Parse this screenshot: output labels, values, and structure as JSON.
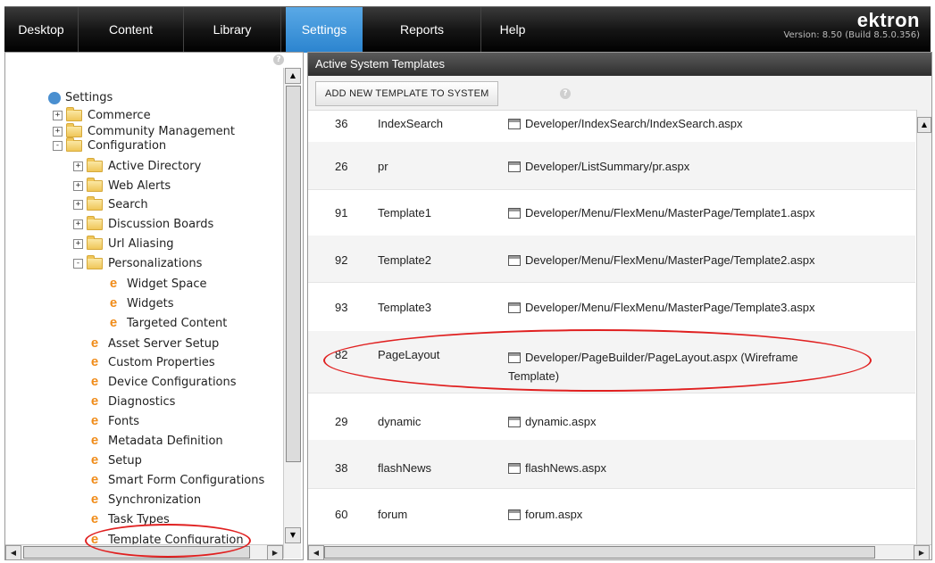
{
  "nav": {
    "tabs": [
      {
        "label": "Desktop"
      },
      {
        "label": "Content"
      },
      {
        "label": "Library"
      },
      {
        "label": "Settings",
        "active": true
      },
      {
        "label": "Reports"
      },
      {
        "label": "Help"
      }
    ],
    "brand": "ektron",
    "version": "Version: 8.50 (Build 8.5.0.356)"
  },
  "tree": {
    "root": "Settings",
    "items": [
      {
        "label": "Commerce",
        "type": "folder",
        "state": "+"
      },
      {
        "label": "Community Management",
        "type": "folder",
        "state": "+"
      },
      {
        "label": "Configuration",
        "type": "folder",
        "state": "-"
      },
      {
        "label": "Active Directory",
        "type": "folder",
        "state": "+"
      },
      {
        "label": "Web Alerts",
        "type": "folder",
        "state": "+"
      },
      {
        "label": "Search",
        "type": "folder",
        "state": "+"
      },
      {
        "label": "Discussion Boards",
        "type": "folder",
        "state": "+"
      },
      {
        "label": "Url Aliasing",
        "type": "folder",
        "state": "+"
      },
      {
        "label": "Personalizations",
        "type": "folder",
        "state": "-"
      },
      {
        "label": "Widget Space",
        "type": "leaf"
      },
      {
        "label": "Widgets",
        "type": "leaf"
      },
      {
        "label": "Targeted Content",
        "type": "leaf"
      },
      {
        "label": "Asset Server Setup",
        "type": "leaf"
      },
      {
        "label": "Custom Properties",
        "type": "leaf"
      },
      {
        "label": "Device Configurations",
        "type": "leaf"
      },
      {
        "label": "Diagnostics",
        "type": "leaf"
      },
      {
        "label": "Fonts",
        "type": "leaf"
      },
      {
        "label": "Metadata Definition",
        "type": "leaf"
      },
      {
        "label": "Setup",
        "type": "leaf"
      },
      {
        "label": "Smart Form Configurations",
        "type": "leaf"
      },
      {
        "label": "Synchronization",
        "type": "leaf"
      },
      {
        "label": "Task Types",
        "type": "leaf"
      },
      {
        "label": "Template Configuration",
        "type": "leaf",
        "highlighted": true
      }
    ]
  },
  "main": {
    "title": "Active System Templates",
    "add_button": "ADD NEW TEMPLATE TO SYSTEM",
    "help_glyph": "?",
    "rows": [
      {
        "id": "36",
        "name": "IndexSearch",
        "path": "Developer/IndexSearch/IndexSearch.aspx"
      },
      {
        "id": "26",
        "name": "pr",
        "path": "Developer/ListSummary/pr.aspx"
      },
      {
        "id": "91",
        "name": "Template1",
        "path": "Developer/Menu/FlexMenu/MasterPage/Template1.aspx"
      },
      {
        "id": "92",
        "name": "Template2",
        "path": "Developer/Menu/FlexMenu/MasterPage/Template2.aspx"
      },
      {
        "id": "93",
        "name": "Template3",
        "path": "Developer/Menu/FlexMenu/MasterPage/Template3.aspx"
      },
      {
        "id": "82",
        "name": "PageLayout",
        "path": "Developer/PageBuilder/PageLayout.aspx (Wireframe",
        "path2": "Template)",
        "highlighted": true
      },
      {
        "id": "29",
        "name": "dynamic",
        "path": "dynamic.aspx"
      },
      {
        "id": "38",
        "name": "flashNews",
        "path": "flashNews.aspx"
      },
      {
        "id": "60",
        "name": "forum",
        "path": "forum.aspx"
      }
    ]
  },
  "colors": {
    "active_tab": "#3b93d8",
    "annotation": "#e02020",
    "leaf_icon": "#f08c1a"
  }
}
